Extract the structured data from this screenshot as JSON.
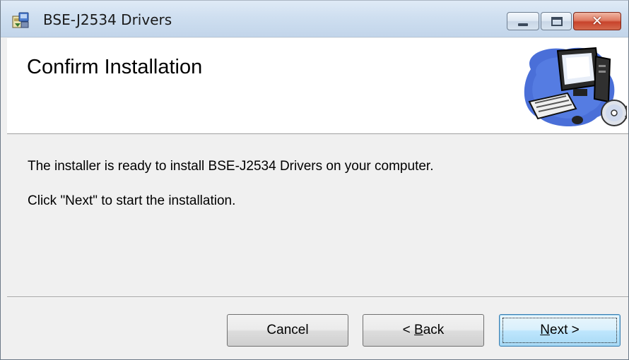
{
  "window": {
    "title": "BSE-J2534 Drivers",
    "close_glyph": "✕"
  },
  "banner": {
    "heading": "Confirm Installation"
  },
  "content": {
    "line1": "The installer is ready to install BSE-J2534 Drivers on your computer.",
    "line2": "Click \"Next\" to start the installation."
  },
  "buttons": {
    "cancel": "Cancel",
    "back_prefix": "< ",
    "back_accel": "B",
    "back_rest": "ack",
    "next_accel": "N",
    "next_rest": "ext >"
  },
  "icons": {
    "app": "installer-package-icon",
    "banner": "computer-with-cd-icon"
  },
  "colors": {
    "titlebar": "#cfdff0",
    "close_button": "#c8432c",
    "default_button": "#bee6fd"
  }
}
